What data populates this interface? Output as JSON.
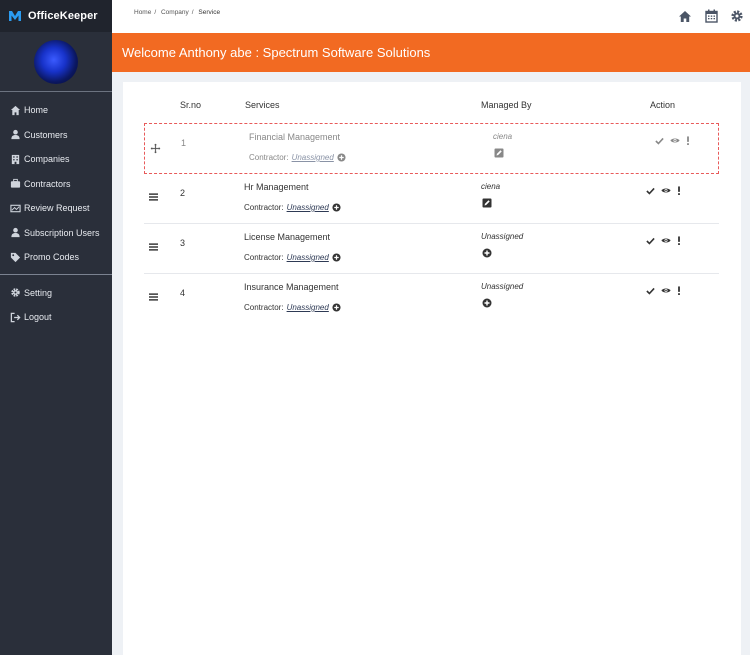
{
  "brand": {
    "name": "OfficeKeeper"
  },
  "sidebar": {
    "items": [
      {
        "label": "Home",
        "icon": "home-icon"
      },
      {
        "label": "Customers",
        "icon": "user-icon"
      },
      {
        "label": "Companies",
        "icon": "building-icon"
      },
      {
        "label": "Contractors",
        "icon": "briefcase-icon"
      },
      {
        "label": "Review Request",
        "icon": "review-icon"
      },
      {
        "label": "Subscription Users",
        "icon": "user-icon"
      },
      {
        "label": "Promo Codes",
        "icon": "tags-icon"
      }
    ],
    "bottom_items": [
      {
        "label": "Setting",
        "icon": "gear-icon"
      },
      {
        "label": "Logout",
        "icon": "logout-icon"
      }
    ]
  },
  "breadcrumb": {
    "home": "Home",
    "company": "Company",
    "current": "Service",
    "sep": "/"
  },
  "banner": {
    "text": "Welcome Anthony abe : Spectrum Software Solutions",
    "color": "#f26a22"
  },
  "table": {
    "headers": {
      "srno": "Sr.no",
      "services": "Services",
      "managed_by": "Managed By",
      "action": "Action"
    },
    "contractor_label": "Contractor:",
    "rows": [
      {
        "srno": "1",
        "service": "Financial Management",
        "contractor": "Unassigned",
        "managed_by": "ciena",
        "managed_icon": "edit-icon",
        "state": "dragging"
      },
      {
        "srno": "2",
        "service": "Hr Management",
        "contractor": "Unassigned",
        "managed_by": "ciena",
        "managed_icon": "edit-icon"
      },
      {
        "srno": "3",
        "service": "License Management",
        "contractor": "Unassigned",
        "managed_by": "Unassigned",
        "managed_icon": "plus-circle-icon"
      },
      {
        "srno": "4",
        "service": "Insurance Management",
        "contractor": "Unassigned",
        "managed_by": "Unassigned",
        "managed_icon": "plus-circle-icon"
      }
    ]
  }
}
